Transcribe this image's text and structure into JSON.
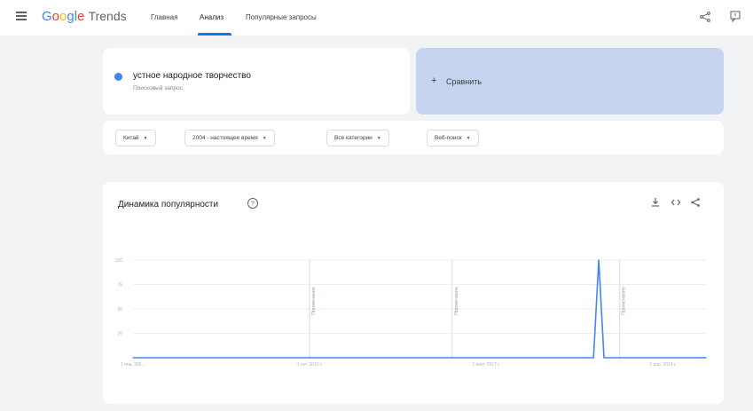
{
  "header": {
    "logo_google": [
      "G",
      "o",
      "o",
      "g",
      "l",
      "e"
    ],
    "logo_trends": "Trends",
    "tabs": [
      {
        "label": "Главная",
        "active": false
      },
      {
        "label": "Анализ",
        "active": true
      },
      {
        "label": "Популярные запросы",
        "active": false
      }
    ],
    "icons": [
      "menu-icon",
      "share-icon",
      "feedback-icon"
    ],
    "accent_color": "#1a73e8"
  },
  "search": {
    "term": "устное народное творчество",
    "term_type": "Поисковый запрос",
    "term_color": "#4285f4",
    "compare_label": "Сравнить",
    "compare_icon": "plus-icon"
  },
  "filters": [
    {
      "label": "Китай"
    },
    {
      "label": "2004 - настоящее время"
    },
    {
      "label": "Все категории"
    },
    {
      "label": "Веб-поиск"
    }
  ],
  "chart_panel": {
    "title": "Динамика популярности",
    "icons": [
      "help-icon",
      "download-icon",
      "embed-icon",
      "share-icon"
    ]
  },
  "chart_data": {
    "type": "line",
    "title": "Динамика популярности",
    "xlabel": "",
    "ylabel": "",
    "ylim": [
      0,
      100
    ],
    "y_ticks": [
      "100",
      "75",
      "50",
      "25"
    ],
    "x_ticks": [
      "1 янв. 200...",
      "1 окт. 2010 г.",
      "1 июл. 2017 г.",
      "1 апр. 2024 г."
    ],
    "grid": true,
    "notes": [
      "Примечание",
      "Примечание",
      "Примечание"
    ],
    "series": [
      {
        "color": "#4285f4",
        "points": [
          {
            "x": 2004.0,
            "y": 0
          },
          {
            "x": 2021.6,
            "y": 0
          },
          {
            "x": 2021.8,
            "y": 100
          },
          {
            "x": 2022.0,
            "y": 0
          },
          {
            "x": 2025.9,
            "y": 0
          }
        ]
      }
    ],
    "note_positions_years": [
      2010.75,
      2016.2,
      2022.6
    ]
  }
}
